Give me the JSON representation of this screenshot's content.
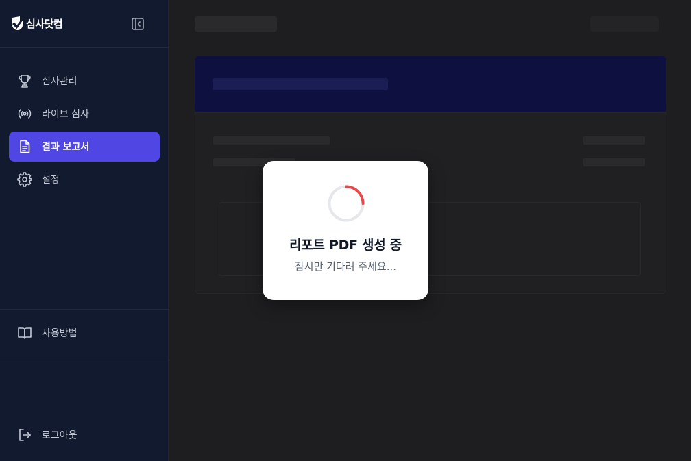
{
  "app": {
    "logo_text": "심사닷컴"
  },
  "sidebar": {
    "items": [
      {
        "label": "심사관리",
        "icon": "trophy-icon",
        "active": false
      },
      {
        "label": "라이브 심사",
        "icon": "broadcast-icon",
        "active": false
      },
      {
        "label": "결과 보고서",
        "icon": "document-icon",
        "active": true
      },
      {
        "label": "설정",
        "icon": "gear-icon",
        "active": false
      }
    ],
    "guide_label": "사용방법",
    "logout_label": "로그아웃"
  },
  "modal": {
    "title": "리포트 PDF 생성 중",
    "subtitle": "잠시만 기다려 주세요...",
    "spinner_progress": 0.25
  },
  "colors": {
    "sidebar_bg": "#111a2e",
    "active_item": "#5046e4",
    "spinner_track": "#e5e7eb",
    "spinner_arc": "#e5484d",
    "overlay": "#1e1e21"
  }
}
